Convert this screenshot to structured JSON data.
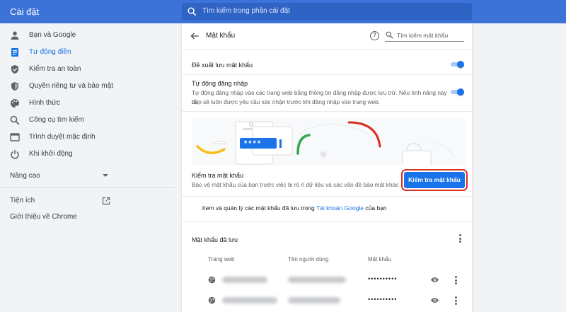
{
  "header": {
    "app_title": "Cài đặt",
    "search_placeholder": "Tìm kiếm trong phần cài đặt",
    "accent_color": "#3b73d8"
  },
  "sidebar": {
    "items": [
      {
        "label": "Bạn và Google",
        "icon": "person-icon"
      },
      {
        "label": "Tự động điền",
        "icon": "autofill-icon",
        "active": true
      },
      {
        "label": "Kiểm tra an toàn",
        "icon": "shield-check-icon"
      },
      {
        "label": "Quyền riêng tư và bảo mật",
        "icon": "shield-icon"
      },
      {
        "label": "Hình thức",
        "icon": "palette-icon"
      },
      {
        "label": "Công cụ tìm kiếm",
        "icon": "search-icon"
      },
      {
        "label": "Trình duyệt mặc định",
        "icon": "browser-icon"
      },
      {
        "label": "Khi khởi động",
        "icon": "power-icon"
      }
    ],
    "advanced": "Nâng cao",
    "extensions": "Tiện ích",
    "about": "Giới thiệu về Chrome"
  },
  "page": {
    "title": "Mật khẩu",
    "search_placeholder": "Tìm kiếm mật khẩu",
    "offer_save": "Đề xuất lưu mật khẩu",
    "offer_save_on": true,
    "auto_signin_title": "Tự động đăng nhập",
    "auto_signin_desc_1": "Tự động đăng nhập vào các trang web bằng thông tin đăng nhập được lưu trữ. Nếu tính năng này tắt,",
    "auto_signin_desc_2": "bạn sẽ luôn được yêu cầu xác nhận trước khi đăng nhập vào trang web.",
    "auto_signin_on": true,
    "banner_mask": "****",
    "check_title": "Kiểm tra mật khẩu",
    "check_desc": "Bảo vệ mật khẩu của bạn trước việc bị rò rỉ dữ liệu và các vấn đề bảo mật khác",
    "check_button": "Kiểm tra mật khẩu",
    "manage_prefix": "Xem và quản lý các mật khẩu đã lưu trong ",
    "manage_link": "Tài khoản Google",
    "manage_suffix": " của bạn",
    "saved_title": "Mật khẩu đã lưu",
    "columns": [
      "Trang web",
      "Tên người dùng",
      "Mật khẩu"
    ],
    "rows": [
      {
        "password": "••••••••••"
      },
      {
        "password": "••••••••••"
      }
    ]
  }
}
